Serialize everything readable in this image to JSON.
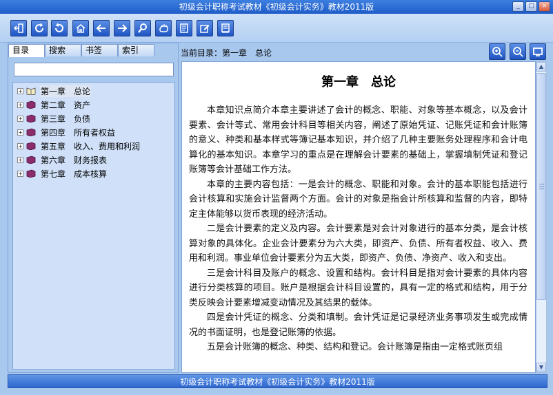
{
  "window": {
    "title": "初级会计职称考试教材《初级会计实务》教材2011版",
    "minimize_label": "_",
    "maximize_label": "□",
    "close_label": "×"
  },
  "toolbar": {
    "buttons": [
      {
        "icon": "exit-icon"
      },
      {
        "icon": "refresh-icon"
      },
      {
        "icon": "undo-icon"
      },
      {
        "icon": "home-icon"
      },
      {
        "icon": "back-arrow-icon"
      },
      {
        "icon": "forward-arrow-icon"
      },
      {
        "icon": "search-icon"
      },
      {
        "icon": "hand-icon"
      },
      {
        "icon": "notes-icon"
      },
      {
        "icon": "edit-icon"
      },
      {
        "icon": "book-icon"
      }
    ]
  },
  "sidebar": {
    "tabs": [
      {
        "label": "目录",
        "active": true
      },
      {
        "label": "搜索",
        "active": false
      },
      {
        "label": "书签",
        "active": false
      },
      {
        "label": "索引",
        "active": false
      }
    ],
    "search_value": "",
    "tree": [
      {
        "label": "第一章　总论",
        "selected": true,
        "expanded": false
      },
      {
        "label": "第二章　资产",
        "selected": false,
        "expanded": false
      },
      {
        "label": "第三章　负债",
        "selected": false,
        "expanded": false
      },
      {
        "label": "第四章　所有者权益",
        "selected": false,
        "expanded": false
      },
      {
        "label": "第五章　收入、费用和利润",
        "selected": false,
        "expanded": false
      },
      {
        "label": "第六章　财务报表",
        "selected": false,
        "expanded": false
      },
      {
        "label": "第七章　成本核算",
        "selected": false,
        "expanded": false
      }
    ]
  },
  "reader": {
    "breadcrumb": "当前目录：第一章　总论",
    "heading": "第一章　总论",
    "paragraphs": [
      "本章知识点简介本章主要讲述了会计的概念、职能、对象等基本概念，以及会计要素、会计等式、常用会计科目等相关内容，阐述了原始凭证、记账凭证和会计账簿的意义、种类和基本样式等簿记基本知识，并介绍了几种主要账务处理程序和会计电算化的基本知识。本章学习的重点是在理解会计要素的基础上，掌握填制凭证和登记账簿等会计基础工作方法。",
      "本章的主要内容包括：一是会计的概念、职能和对象。会计的基本职能包括进行会计核算和实施会计监督两个方面。会计的对象是指会计所核算和监督的内容，即特定主体能够以货币表现的经济活动。",
      "二是会计要素的定义及内容。会计要素是对会计对象进行的基本分类，是会计核算对象的具体化。企业会计要素分为六大类，即资产、负债、所有者权益、收入、费用和利润。事业单位会计要素分为五大类，即资产、负债、净资产、收入和支出。",
      "三是会计科目及账户的概念、设置和结构。会计科目是指对会计要素的具体内容进行分类核算的项目。账户是根据会计科目设置的，具有一定的格式和结构，用于分类反映会计要素增减变动情况及其结果的载体。",
      "四是会计凭证的概念、分类和填制。会计凭证是记录经济业务事项发生或完成情况的书面证明，也是登记账簿的依据。",
      "五是会计账簿的概念、种类、结构和登记。会计账簿是指由一定格式账页组"
    ],
    "zoom_buttons": [
      {
        "icon": "zoom-in-icon"
      },
      {
        "icon": "zoom-out-icon"
      },
      {
        "icon": "fit-window-icon"
      }
    ]
  },
  "statusbar": {
    "text": "初级会计职称考试教材《初级会计实务》教材2011版"
  },
  "colors": {
    "title_bar": "#2f6fd8",
    "app_background": "#a9c8ee",
    "tree_background": "#cfe0f8",
    "status_bar": "#3b73d6"
  }
}
